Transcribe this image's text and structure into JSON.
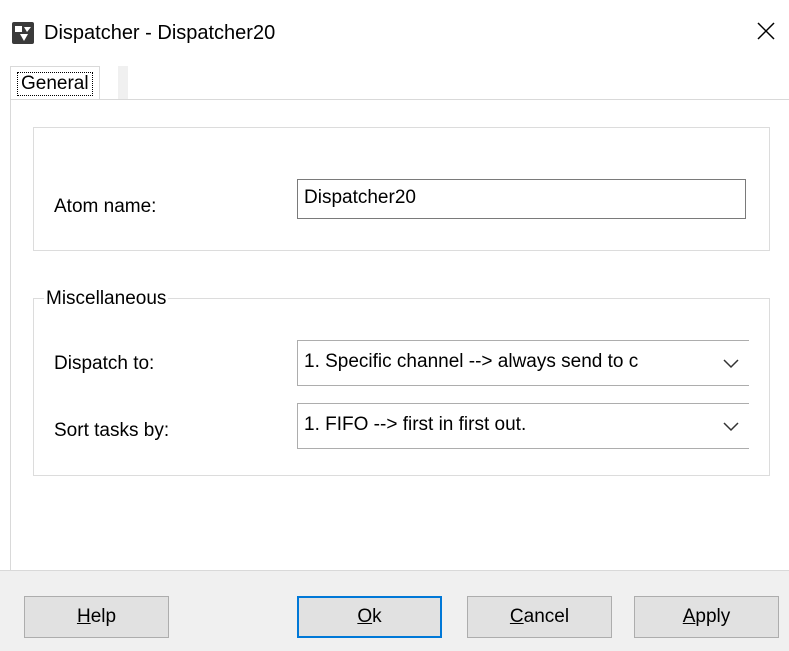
{
  "window": {
    "title": "Dispatcher - Dispatcher20",
    "app_icon": "dispatcher-app-icon",
    "close_icon": "close-icon"
  },
  "tabs": [
    {
      "label": "General",
      "selected": true
    }
  ],
  "fields": {
    "atom_name": {
      "label": "Atom name:",
      "value": "Dispatcher20"
    }
  },
  "miscellaneous": {
    "legend": "Miscellaneous",
    "dispatch_to": {
      "label": "Dispatch to:",
      "value": "1. Specific channel --> always send to c"
    },
    "sort_tasks_by": {
      "label": "Sort tasks by:",
      "value": "1. FIFO --> first in first out."
    }
  },
  "buttons": {
    "help": {
      "mnemonic": "H",
      "rest": "elp"
    },
    "ok": {
      "mnemonic": "O",
      "rest": "k"
    },
    "cancel": {
      "mnemonic": "C",
      "rest": "ancel"
    },
    "apply": {
      "mnemonic": "A",
      "rest": "pply"
    }
  },
  "colors": {
    "accent": "#0078d7",
    "button_face": "#e1e1e1",
    "dialog_bg": "#f0f0f0"
  }
}
